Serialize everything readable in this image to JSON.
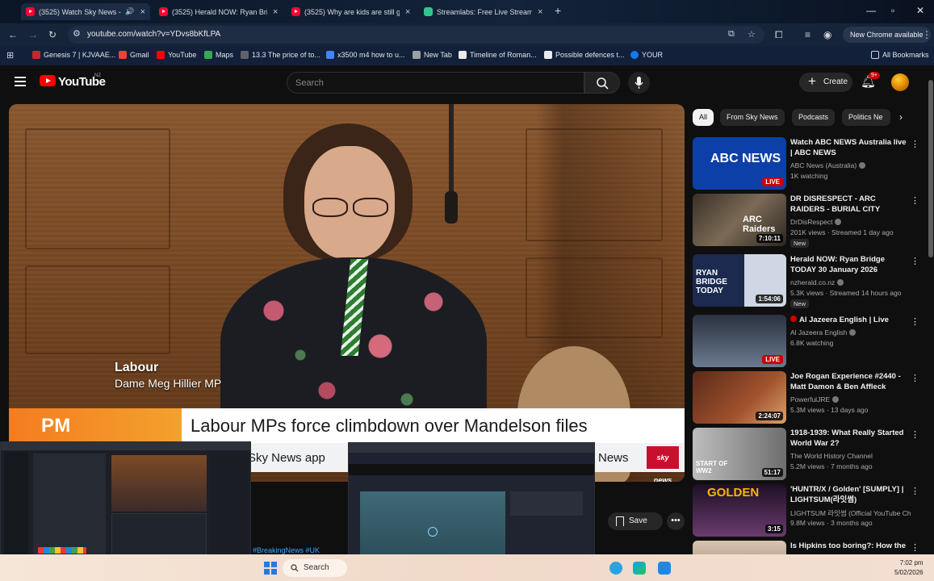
{
  "browser": {
    "tabs": [
      {
        "title": "(3525) Watch Sky News - Yo",
        "active": true
      },
      {
        "title": "(3525) Herald NOW: Ryan Bridg",
        "active": false
      },
      {
        "title": "(3525) Why are kids are still go",
        "active": false
      },
      {
        "title": "Streamlabs: Free Live Streaming",
        "active": false
      }
    ],
    "url": "youtube.com/watch?v=YDvs8bKfLPA",
    "new_chrome_label": "New Chrome available",
    "bookmarks": [
      {
        "label": "Genesis 7 | KJVAAE...",
        "color": "#c62828"
      },
      {
        "label": "Gmail",
        "color": "#ea4335"
      },
      {
        "label": "YouTube",
        "color": "#ff0000"
      },
      {
        "label": "Maps",
        "color": "#34a853"
      },
      {
        "label": "13.3 The price of to...",
        "color": "#5f6368"
      },
      {
        "label": "x3500 m4 how to u...",
        "color": "#4285f4"
      },
      {
        "label": "New Tab",
        "color": "#9aa0a6"
      },
      {
        "label": "Timeline of Roman...",
        "color": "#e8eaed"
      },
      {
        "label": "Possible defences t...",
        "color": "#e8eaed"
      },
      {
        "label": "YOUR",
        "color": "#1877f2"
      }
    ],
    "all_bookmarks_label": "All Bookmarks"
  },
  "youtube": {
    "logo_text": "YouTube",
    "country_code": "NZ",
    "search_placeholder": "Search",
    "create_label": "Create",
    "notification_count": "9+",
    "video": {
      "party": "Labour",
      "speaker": "Dame Meg Hillier MP",
      "banner_tag": "PM PRESSURE",
      "headline": "Labour MPs force climbdown over Mandelson files",
      "ticker_left": "Sky News app",
      "ticker_right": "News",
      "ticker_logo": "sky news"
    },
    "save_label": "Save",
    "hashtags": "#BreakingNews #UK",
    "chips": [
      "All",
      "From Sky News",
      "Podcasts",
      "Politics Ne"
    ],
    "recommendations": [
      {
        "title": "Watch ABC NEWS Australia live | ABC NEWS",
        "channel": "ABC News (Australia)",
        "meta": "1K watching",
        "badge": "LIVE",
        "thumb_text": "ABC NEWS",
        "is_new": false
      },
      {
        "title": "DR DISRESPECT - ARC RAIDERS - BURIAL CITY KILLAS",
        "channel": "DrDisRespect",
        "meta": "201K views · Streamed 1 day ago",
        "badge": "7:10:11",
        "thumb_text": "ARC Raiders",
        "is_new": true
      },
      {
        "title": "Herald NOW: Ryan Bridge TODAY 30 January 2026",
        "channel": "nzherald.co.nz",
        "meta": "5.3K views · Streamed 14 hours ago",
        "badge": "1:54:06",
        "thumb_text": "RYAN BRIDGE TODAY",
        "is_new": true
      },
      {
        "title": "Al Jazeera English | Live",
        "channel": "Al Jazeera English",
        "meta": "6.8K watching",
        "badge": "LIVE",
        "thumb_text": "",
        "is_new": false
      },
      {
        "title": "Joe Rogan Experience #2440 - Matt Damon & Ben Affleck",
        "channel": "PowerfulJRE",
        "meta": "5.3M views · 13 days ago",
        "badge": "2:24:07",
        "thumb_text": "",
        "is_new": false
      },
      {
        "title": "1918-1939: What Really Started World War 2?",
        "channel": "The World History Channel",
        "meta": "5.2M views · 7 months ago",
        "badge": "51:17",
        "thumb_text": "START OF WW2",
        "is_new": false
      },
      {
        "title": "'HUNTR/X / Golden' [SUMPLY] | LIGHTSUM(라잇썸)",
        "channel": "LIGHTSUM 라잇썸 (Official YouTube Cha...",
        "meta": "9.8M views · 3 months ago",
        "badge": "3:15",
        "thumb_text": "GOLDEN",
        "is_new": false
      },
      {
        "title": "Is Hipkins too boring?: How the",
        "channel": "",
        "meta": "",
        "badge": "",
        "thumb_text": "",
        "is_new": false
      }
    ]
  },
  "taskbar": {
    "search_label": "Search",
    "time": "7:02 pm",
    "date": "5/02/2026"
  }
}
